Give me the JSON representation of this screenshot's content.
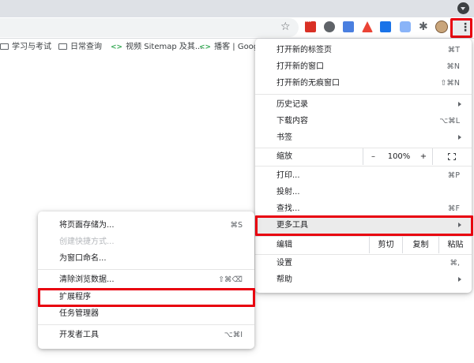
{
  "toolbar": {
    "star_icon": "star-icon",
    "menu_icon": "more-vert-icon",
    "extensions_icon": "puzzle-icon"
  },
  "bookmarks": [
    {
      "label": "学习与考试",
      "icon": "folder-icon"
    },
    {
      "label": "日常查询",
      "icon": "folder-icon"
    },
    {
      "label": "视频 Sitemap 及其...",
      "icon": "code-icon"
    },
    {
      "label": "播客 | Goog",
      "icon": "code-icon"
    }
  ],
  "main_menu": {
    "new_tab": {
      "label": "打开新的标签页",
      "shortcut": "⌘T"
    },
    "new_window": {
      "label": "打开新的窗口",
      "shortcut": "⌘N"
    },
    "new_incognito": {
      "label": "打开新的无痕窗口",
      "shortcut": "⇧⌘N"
    },
    "history": {
      "label": "历史记录"
    },
    "downloads": {
      "label": "下载内容",
      "shortcut": "⌥⌘L"
    },
    "bookmarks": {
      "label": "书签"
    },
    "zoom": {
      "label": "缩放",
      "minus": "–",
      "value": "100%",
      "plus": "+"
    },
    "print": {
      "label": "打印...",
      "shortcut": "⌘P"
    },
    "cast": {
      "label": "投射..."
    },
    "find": {
      "label": "查找...",
      "shortcut": "⌘F"
    },
    "more_tools": {
      "label": "更多工具"
    },
    "edit": {
      "label": "编辑",
      "cut": "剪切",
      "copy": "复制",
      "paste": "粘贴"
    },
    "settings": {
      "label": "设置",
      "shortcut": "⌘,"
    },
    "help": {
      "label": "帮助"
    }
  },
  "sub_menu": {
    "save_page": {
      "label": "将页面存储为...",
      "shortcut": "⌘S"
    },
    "create_shortcut": {
      "label": "创建快捷方式..."
    },
    "name_window": {
      "label": "为窗口命名..."
    },
    "clear_data": {
      "label": "清除浏览数据...",
      "shortcut": "⇧⌘⌫"
    },
    "extensions": {
      "label": "扩展程序"
    },
    "task_manager": {
      "label": "任务管理器"
    },
    "dev_tools": {
      "label": "开发者工具",
      "shortcut": "⌥⌘I"
    }
  },
  "colors": {
    "highlight_border": "#e8000f",
    "hover_bg": "#ebebeb"
  }
}
